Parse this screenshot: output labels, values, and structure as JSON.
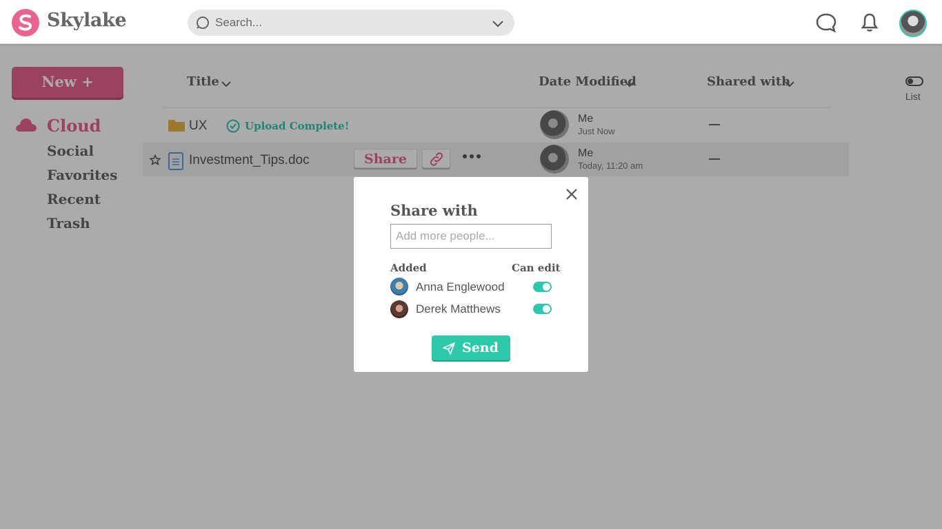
{
  "app": {
    "name": "Skylake"
  },
  "search": {
    "placeholder": "Search..."
  },
  "sidebar": {
    "new_label": "New +",
    "items": [
      {
        "label": "Cloud",
        "active": true
      },
      {
        "label": "Social"
      },
      {
        "label": "Favorites"
      },
      {
        "label": "Recent"
      },
      {
        "label": "Trash"
      }
    ]
  },
  "table": {
    "columns": [
      "Title",
      "Date Modified",
      "Shared with"
    ],
    "view_toggle_label": "List",
    "rows": [
      {
        "name": "UX",
        "type": "folder",
        "status": "Upload Complete!",
        "owner": "Me",
        "modified": "Just Now",
        "shared": "—"
      },
      {
        "name": "Investment_Tips.doc",
        "type": "document",
        "owner": "Me",
        "modified": "Today, 11:20 am",
        "shared": "—"
      }
    ],
    "row_actions": {
      "share_label": "Share"
    }
  },
  "modal": {
    "title": "Share with",
    "input_placeholder": "Add more people...",
    "added_header": "Added",
    "can_edit_header": "Can edit",
    "people": [
      {
        "name": "Anna Englewood",
        "can_edit": true
      },
      {
        "name": "Derek Matthews",
        "can_edit": true
      }
    ],
    "send_label": "Send"
  },
  "colors": {
    "brand": "#e8638f",
    "accent": "#2ec8aa",
    "folder": "#e8b341",
    "doc": "#5b9bd5"
  }
}
